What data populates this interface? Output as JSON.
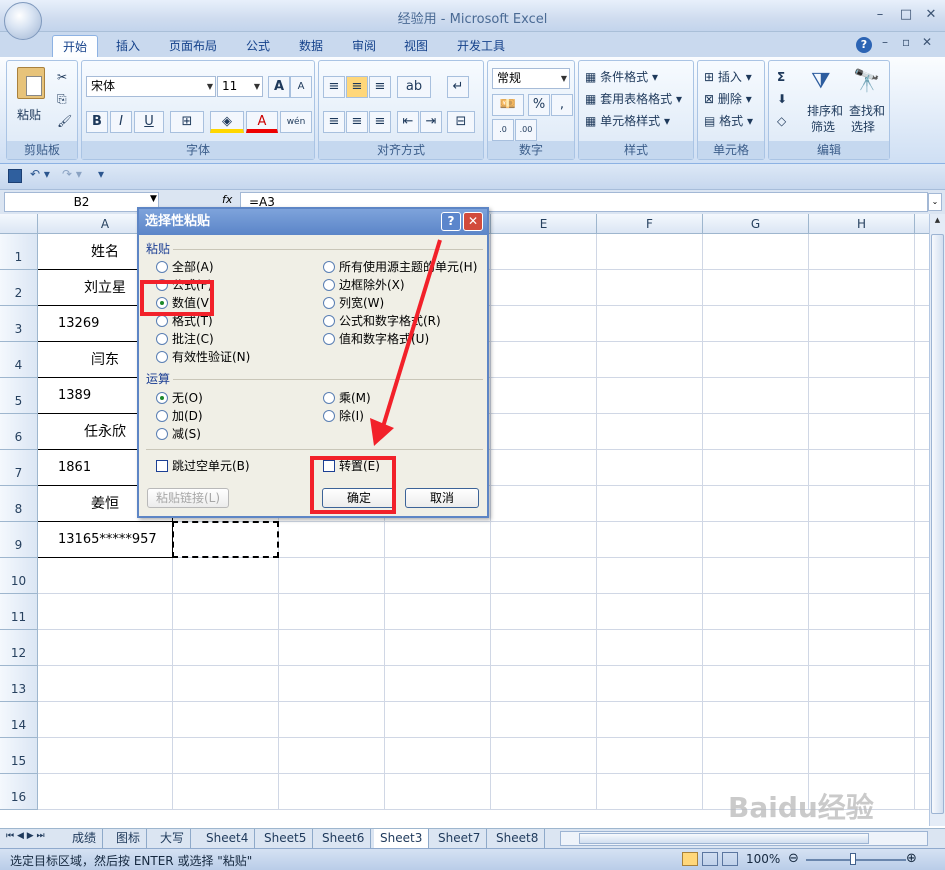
{
  "window": {
    "title": "经验用 - Microsoft Excel",
    "controls": [
      "–",
      "□",
      "✕"
    ]
  },
  "tabs": [
    "开始",
    "插入",
    "页面布局",
    "公式",
    "数据",
    "审阅",
    "视图",
    "开发工具"
  ],
  "ribbon": {
    "clipboard": {
      "label": "剪贴板",
      "paste": "粘贴"
    },
    "font": {
      "label": "字体",
      "name": "宋体",
      "size": "11",
      "bold": "B",
      "italic": "I",
      "underline": "U",
      "wen": "wén",
      "grow": "A",
      "shrink": "A"
    },
    "alignment": {
      "label": "对齐方式"
    },
    "number": {
      "label": "数字",
      "format": "常规",
      "percent": "%",
      "comma": ","
    },
    "styles": {
      "label": "样式",
      "conditional": "条件格式",
      "table": "套用表格格式",
      "cell": "单元格样式"
    },
    "cells": {
      "label": "单元格",
      "insert": "插入",
      "delete": "删除",
      "format": "格式"
    },
    "editing": {
      "label": "编辑",
      "sort": "排序和",
      "sort2": "筛选",
      "find": "查找和",
      "find2": "选择",
      "sigma": "Σ"
    }
  },
  "formula_bar": {
    "name_box": "B2",
    "fx": "fx",
    "formula": "=A3"
  },
  "grid": {
    "columns": [
      "A",
      "B",
      "C",
      "D",
      "E",
      "F",
      "G",
      "H"
    ],
    "rows": [
      "1",
      "2",
      "3",
      "4",
      "5",
      "6",
      "7",
      "8",
      "9",
      "10",
      "11",
      "12",
      "13",
      "14",
      "15",
      "16"
    ],
    "a_values": [
      "姓名",
      "刘立星",
      "13269",
      "闫东",
      "1389",
      "任永欣",
      "1861",
      "姜恒",
      "13165*****957"
    ]
  },
  "dialog": {
    "title": "选择性粘贴",
    "help": "?",
    "close": "✕",
    "paste_section": "粘贴",
    "paste_left": [
      "全部(A)",
      "公式(F)",
      "数值(V)",
      "格式(T)",
      "批注(C)",
      "有效性验证(N)"
    ],
    "paste_right": [
      "所有使用源主题的单元(H)",
      "边框除外(X)",
      "列宽(W)",
      "公式和数字格式(R)",
      "值和数字格式(U)"
    ],
    "operation_section": "运算",
    "op_left": [
      "无(O)",
      "加(D)",
      "减(S)"
    ],
    "op_right": [
      "乘(M)",
      "除(I)"
    ],
    "skip_blanks": "跳过空单元(B)",
    "transpose": "转置(E)",
    "paste_link": "粘贴链接(L)",
    "ok": "确定",
    "cancel": "取消"
  },
  "sheets": [
    "成绩",
    "图标",
    "大写",
    "Sheet4",
    "Sheet5",
    "Sheet6",
    "Sheet3",
    "Sheet7",
    "Sheet8"
  ],
  "active_sheet": "Sheet3",
  "status": {
    "message": "选定目标区域，然后按 ENTER 或选择 \"粘贴\"",
    "zoom": "100%"
  },
  "watermark": "Baidu经验 jingyan.baidu.com"
}
